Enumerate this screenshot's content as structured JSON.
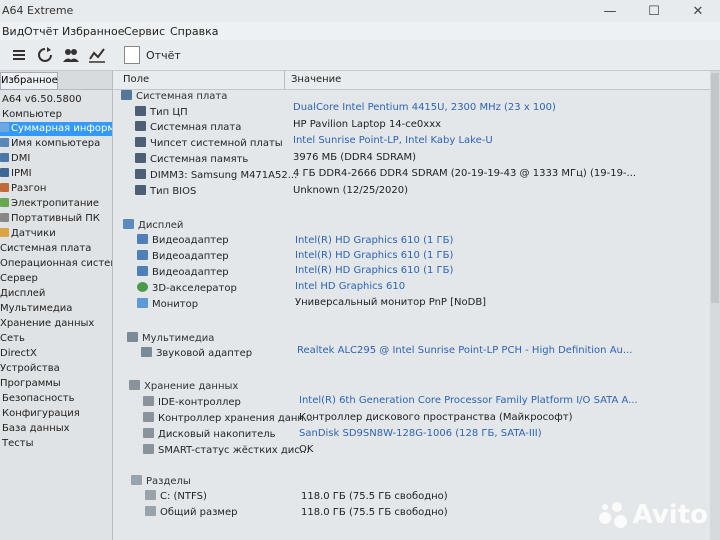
{
  "window": {
    "title": "A64 Extreme",
    "btn_min": "—",
    "btn_max": "☐",
    "btn_close": "✕"
  },
  "menu": [
    "Вид",
    "Отчёт",
    "Избранное",
    "Сервис",
    "Справка"
  ],
  "toolbar": {
    "report_label": "Отчёт"
  },
  "sidebar": {
    "tab_favorites": "Избранное",
    "version": "A64 v6.50.5800",
    "items": [
      "Компьютер",
      "Суммарная информация",
      "Имя компьютера",
      "DMI",
      "IPMI",
      "Разгон",
      "Электропитание",
      "Портативный ПК",
      "Датчики",
      "Системная плата",
      "Операционная система",
      "Сервер",
      "Дисплей",
      "Мультимедиа",
      "Хранение данных",
      "Сеть",
      "DirectX",
      "Устройства",
      "Программы",
      "Безопасность",
      "Конфигурация",
      "База данных",
      "Тесты"
    ]
  },
  "columns": {
    "field": "Поле",
    "value": "Значение"
  },
  "groups": {
    "motherboard": "Системная плата",
    "display": "Дисплей",
    "multimedia": "Мультимедиа",
    "storage": "Хранение данных",
    "partitions": "Разделы"
  },
  "rows": {
    "mb": [
      {
        "label": "Тип ЦП",
        "value": "DualCore Intel Pentium 4415U, 2300 MHz (23 x 100)",
        "link": true
      },
      {
        "label": "Системная плата",
        "value": "HP Pavilion Laptop 14-ce0xxx",
        "link": false
      },
      {
        "label": "Чипсет системной платы",
        "value": "Intel Sunrise Point-LP, Intel Kaby Lake-U",
        "link": true
      },
      {
        "label": "Системная память",
        "value": "3976 МБ  (DDR4 SDRAM)",
        "link": false
      },
      {
        "label": "DIMM3: Samsung M471A52...",
        "value": "4 ГБ DDR4-2666 DDR4 SDRAM  (20-19-19-43 @ 1333 МГц)  (19-19-...",
        "link": false
      },
      {
        "label": "Тип BIOS",
        "value": "Unknown (12/25/2020)",
        "link": false
      }
    ],
    "display": [
      {
        "label": "Видеоадаптер",
        "value": "Intel(R) HD Graphics 610  (1 ГБ)",
        "link": true
      },
      {
        "label": "Видеоадаптер",
        "value": "Intel(R) HD Graphics 610  (1 ГБ)",
        "link": true
      },
      {
        "label": "Видеоадаптер",
        "value": "Intel(R) HD Graphics 610  (1 ГБ)",
        "link": true
      },
      {
        "label": "3D-акселератор",
        "value": "Intel HD Graphics 610",
        "link": true
      },
      {
        "label": "Монитор",
        "value": "Универсальный монитор PnP [NoDB]",
        "link": false
      }
    ],
    "multimedia": [
      {
        "label": "Звуковой адаптер",
        "value": "Realtek ALC295 @ Intel Sunrise Point-LP PCH - High Definition Au...",
        "link": true
      }
    ],
    "storage": [
      {
        "label": "IDE-контроллер",
        "value": "Intel(R) 6th Generation Core Processor Family Platform I/O SATA A...",
        "link": true
      },
      {
        "label": "Контроллер хранения данн...",
        "value": "Контроллер дискового пространства (Майкрософт)",
        "link": false
      },
      {
        "label": "Дисковый накопитель",
        "value": "SanDisk SD9SN8W-128G-1006  (128 ГБ, SATA-III)",
        "link": true
      },
      {
        "label": "SMART-статус жёстких дис...",
        "value": "OK",
        "link": false
      }
    ],
    "partitions": [
      {
        "label": "C: (NTFS)",
        "value": "118.0 ГБ (75.5 ГБ свободно)",
        "link": false
      },
      {
        "label": "Общий размер",
        "value": "118.0 ГБ (75.5 ГБ свободно)",
        "link": false
      }
    ]
  },
  "watermark": "Avito"
}
